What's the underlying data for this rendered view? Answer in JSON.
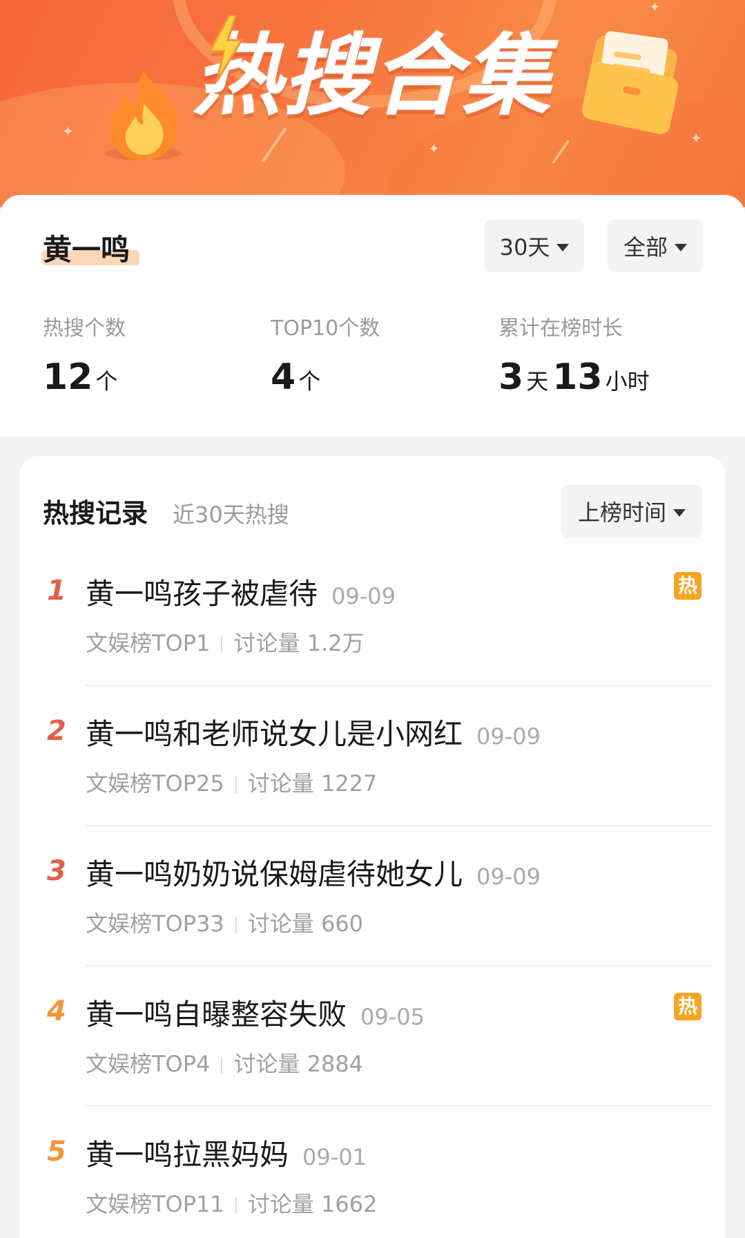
{
  "banner": {
    "title": "热搜合集"
  },
  "summary": {
    "name": "黄一鸣",
    "filters": {
      "days_label": "30天",
      "scope_label": "全部"
    },
    "stats": [
      {
        "label": "热搜个数",
        "value": "12",
        "unit": "个"
      },
      {
        "label": "TOP10个数",
        "value": "4",
        "unit": "个"
      },
      {
        "label": "累计在榜时长",
        "days_value": "3",
        "days_unit": "天",
        "hours_value": "13",
        "hours_unit": "小时"
      }
    ]
  },
  "records": {
    "title": "热搜记录",
    "subtitle": "近30天热搜",
    "sort_label": "上榜时间",
    "items": [
      {
        "rank": "1",
        "title": "黄一鸣孩子被虐待",
        "date": "09-09",
        "board": "文娱榜TOP1",
        "discussion": "讨论量 1.2万",
        "badge": "热"
      },
      {
        "rank": "2",
        "title": "黄一鸣和老师说女儿是小网红",
        "date": "09-09",
        "board": "文娱榜TOP25",
        "discussion": "讨论量 1227",
        "badge": ""
      },
      {
        "rank": "3",
        "title": "黄一鸣奶奶说保姆虐待她女儿",
        "date": "09-09",
        "board": "文娱榜TOP33",
        "discussion": "讨论量 660",
        "badge": ""
      },
      {
        "rank": "4",
        "title": "黄一鸣自曝整容失败",
        "date": "09-05",
        "board": "文娱榜TOP4",
        "discussion": "讨论量 2884",
        "badge": "热"
      },
      {
        "rank": "5",
        "title": "黄一鸣拉黑妈妈",
        "date": "09-01",
        "board": "文娱榜TOP11",
        "discussion": "讨论量 1662",
        "badge": ""
      }
    ]
  },
  "colors": {
    "rank_top3": "#e2604a",
    "rank_other": "#f0963a",
    "hot_badge": "#f5a623",
    "banner": "#f7703c"
  },
  "icons": {
    "banner_left": "flame-icon",
    "banner_right": "folder-icon",
    "title_accent": "lightning-icon",
    "dropdown": "caret-down-icon"
  }
}
